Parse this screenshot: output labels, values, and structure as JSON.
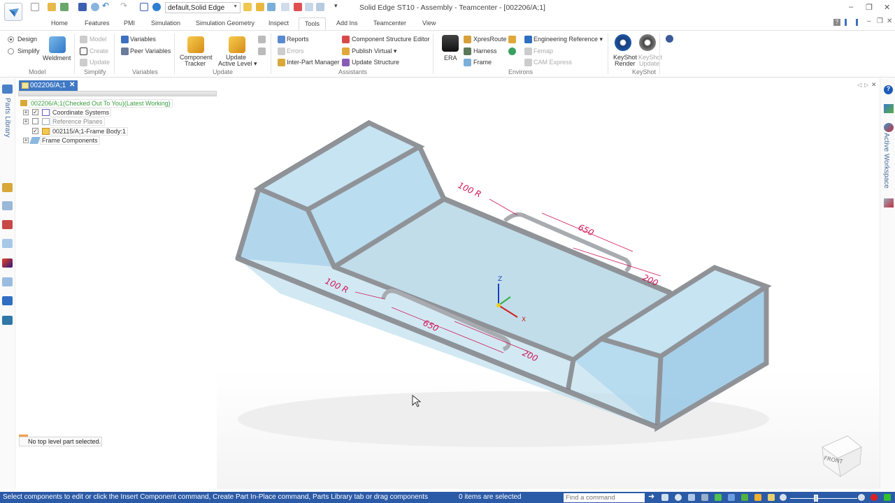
{
  "window": {
    "title": "Solid Edge ST10 - Assembly - Teamcenter - [002206/A;1]",
    "view_combo": "default,Solid Edge",
    "controls": {
      "minimize": "–",
      "restore": "❐",
      "close": "✕"
    },
    "doc_controls": {
      "help": "?",
      "minimize": "–",
      "restore": "❐",
      "close": "✕"
    }
  },
  "tabs": [
    {
      "label": "Home"
    },
    {
      "label": "Features"
    },
    {
      "label": "PMI"
    },
    {
      "label": "Simulation"
    },
    {
      "label": "Simulation Geometry"
    },
    {
      "label": "Inspect"
    },
    {
      "label": "Tools",
      "active": true
    },
    {
      "label": "Add Ins"
    },
    {
      "label": "Teamcenter"
    },
    {
      "label": "View"
    }
  ],
  "ribbon": {
    "model": {
      "group": "Model",
      "design": "Design",
      "simplify": "Simplify",
      "weldment": "Weldment",
      "selected_mode": "Design"
    },
    "simplify": {
      "group": "Simplify",
      "model": "Model",
      "create": "Create",
      "update": "Update"
    },
    "variables": {
      "group": "Variables",
      "variables": "Variables",
      "peer_variables": "Peer Variables"
    },
    "update": {
      "group": "Update",
      "component_tracker_1": "Component",
      "component_tracker_2": "Tracker",
      "update_active_1": "Update",
      "update_active_2": "Active Level ▾"
    },
    "assistants": {
      "group": "Assistants",
      "reports": "Reports",
      "errors": "Errors",
      "inter_part_manager": "Inter-Part Manager",
      "component_structure_editor": "Component Structure Editor",
      "publish_virtual": "Publish Virtual  ▾",
      "update_structure": "Update Structure"
    },
    "environs": {
      "group": "Environs",
      "era": "ERA",
      "xpresroute": "XpresRoute",
      "harness": "Harness",
      "frame": "Frame",
      "engineering_reference": "Engineering Reference ▾",
      "femap": "Femap",
      "cam_express": "CAM Express"
    },
    "keyshot": {
      "group": "KeyShot",
      "render_1": "KeyShot",
      "render_2": "Render",
      "update_1": "KeyShot",
      "update_2": "Update"
    }
  },
  "left_panel": {
    "parts_library": "Parts Library",
    "doc_tab": "002206/A;1",
    "tree": {
      "root": "002206/A;1(Checked Out To You)(Latest Working)",
      "items": [
        {
          "label": "Coordinate Systems",
          "checked": true,
          "expandable": true
        },
        {
          "label": "Reference Planes",
          "checked": false,
          "expandable": true
        },
        {
          "label": "002115/A;1-Frame Body:1",
          "checked": true,
          "expandable": false
        },
        {
          "label": "Frame Components",
          "expandable": true
        }
      ]
    },
    "notice": "No top level part selected."
  },
  "right_panel": {
    "active_workspace": "Active Workspace"
  },
  "viewport": {
    "dimensions": {
      "radius_1": "100 R",
      "length_1": "650",
      "offset_1": "200",
      "radius_2": "100 R",
      "length_2": "650",
      "offset_2": "200"
    },
    "axes": {
      "z": "Z",
      "x": "X"
    },
    "view_cube": "FRONT",
    "colors": {
      "frame": "#8f9398",
      "glass": "#a9d3ea",
      "dimension": "#d0185a",
      "axis_z": "#1a3fc0",
      "axis_x": "#d02020",
      "axis_y": "#30b040"
    }
  },
  "statusbar": {
    "message": "Select components to edit or click the Insert Component command, Create Part In-Place command, Parts Library tab or drag components",
    "selection": "0 items are selected",
    "find_placeholder": "Find a command"
  }
}
